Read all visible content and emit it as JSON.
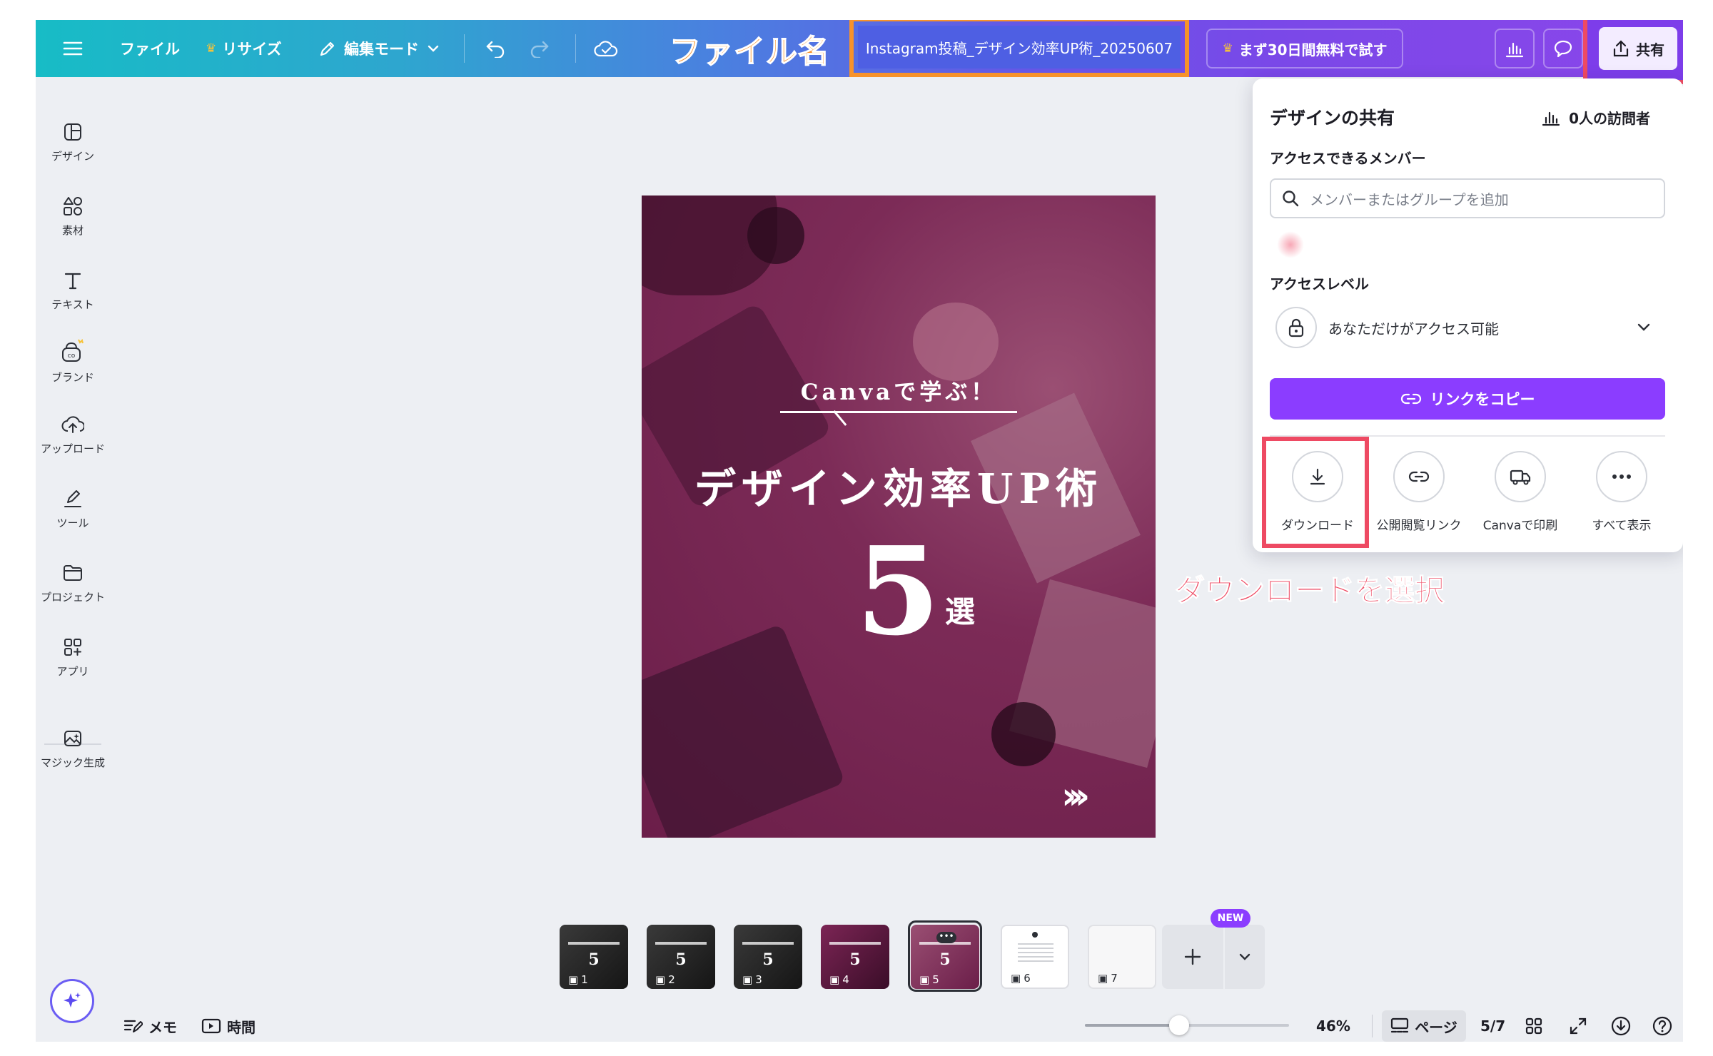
{
  "topbar": {
    "menu_icon": "hamburger-icon",
    "file_label": "ファイル",
    "resize_label": "リサイズ",
    "edit_mode_label": "編集モード",
    "annotation_filename": "ファイル名",
    "filename": "Instagram投稿_デザイン効率UP術_20250607",
    "trial_label": "まず30日間無料で試す",
    "share_label": "共有"
  },
  "sidebar": {
    "items": [
      {
        "label": "デザイン",
        "icon": "design-layout-icon"
      },
      {
        "label": "素材",
        "icon": "elements-icon"
      },
      {
        "label": "テキスト",
        "icon": "text-icon"
      },
      {
        "label": "ブランド",
        "icon": "brand-icon"
      },
      {
        "label": "アップロード",
        "icon": "upload-cloud-icon"
      },
      {
        "label": "ツール",
        "icon": "draw-tool-icon"
      },
      {
        "label": "プロジェクト",
        "icon": "folder-icon"
      },
      {
        "label": "アプリ",
        "icon": "apps-icon"
      },
      {
        "label": "マジック生成",
        "icon": "magic-image-icon"
      }
    ]
  },
  "design": {
    "subtitle": "Canvaで学ぶ！",
    "title": "デザイン効率UP術",
    "number": "5",
    "suffix": "選",
    "arrows": "›››"
  },
  "share_panel": {
    "title": "デザインの共有",
    "visitors": "0人の訪問者",
    "members_label": "アクセスできるメンバー",
    "search_placeholder": "メンバーまたはグループを追加",
    "access_level_label": "アクセスレベル",
    "access_value": "あなただけがアクセス可能",
    "copy_link_label": "リンクをコピー",
    "options": [
      {
        "label": "ダウンロード",
        "icon": "download-icon"
      },
      {
        "label": "公開閲覧リンク",
        "icon": "link-icon"
      },
      {
        "label": "Canvaで印刷",
        "icon": "print-truck-icon"
      },
      {
        "label": "すべて表示",
        "icon": "more-icon"
      }
    ]
  },
  "annotation_download": "ダウンロードを選択",
  "thumbnails": [
    {
      "num": "1"
    },
    {
      "num": "2"
    },
    {
      "num": "3"
    },
    {
      "num": "4"
    },
    {
      "num": "5"
    },
    {
      "num": "6"
    },
    {
      "num": "7"
    }
  ],
  "new_badge": "NEW",
  "bottombar": {
    "notes_label": "メモ",
    "time_label": "時間",
    "zoom_level": 0.46,
    "zoom": "46%",
    "pages_label": "ページ",
    "page_count": "5/7"
  },
  "colors": {
    "accent_purple": "#8b3dff",
    "annotation_orange": "#f7922a",
    "annotation_red": "#ee4a63",
    "design_bg": "#7c2b57"
  }
}
